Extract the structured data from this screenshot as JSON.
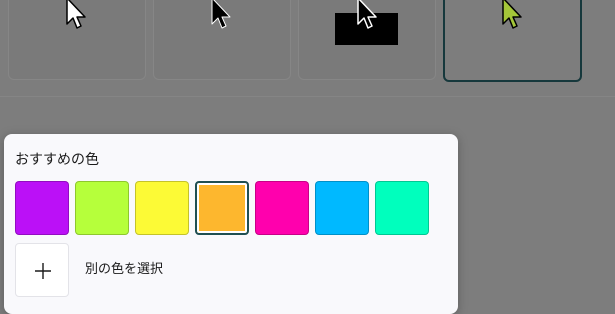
{
  "pointer_styles": [
    {
      "name": "white",
      "icon": "white-pointer-icon"
    },
    {
      "name": "black",
      "icon": "black-pointer-icon"
    },
    {
      "name": "inverted",
      "icon": "inverted-pointer-icon"
    },
    {
      "name": "custom",
      "icon": "custom-color-pointer-icon",
      "selected": true,
      "color": "#a4c639"
    }
  ],
  "color_panel": {
    "title": "おすすめの色",
    "swatches": [
      {
        "color": "#bb10f7"
      },
      {
        "color": "#b6ff3b"
      },
      {
        "color": "#fcfa36"
      },
      {
        "color": "#fdb72e",
        "selected": true
      },
      {
        "color": "#ff00ad"
      },
      {
        "color": "#00b9ff"
      },
      {
        "color": "#00ffbd"
      }
    ],
    "add_button_icon": "plus-icon",
    "add_label": "別の色を選択"
  }
}
